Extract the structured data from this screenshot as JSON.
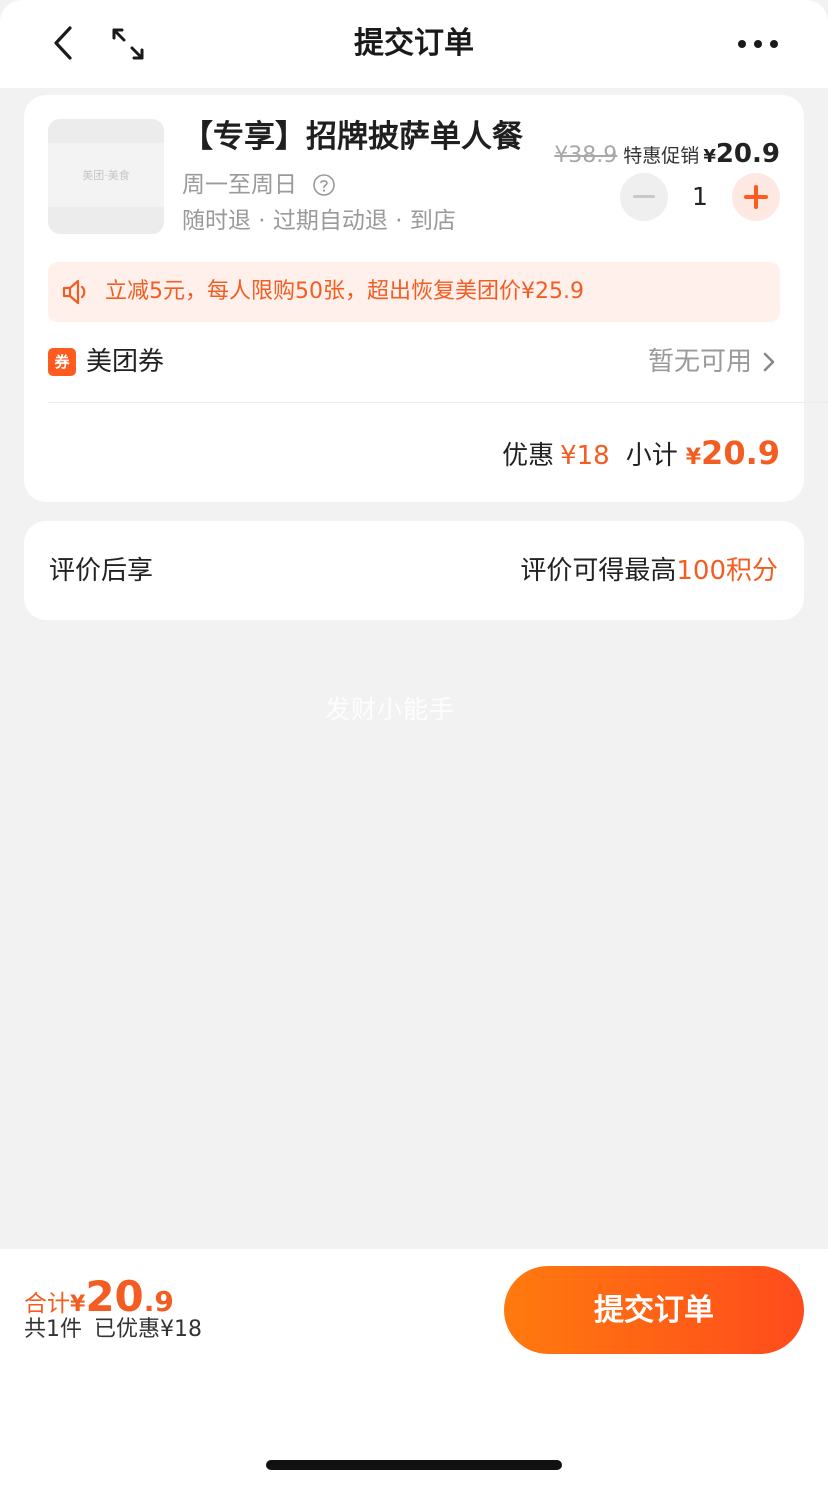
{
  "header": {
    "title": "提交订单"
  },
  "product": {
    "thumb_logo": "美团·美食",
    "title": "【专享】招牌披萨单人餐",
    "days": "周一至周日",
    "rules": "随时退 · 过期自动退 · 到店",
    "original_price": "¥38.9",
    "promo_tag": "特惠促销",
    "price_symbol": "¥",
    "price": "20.9",
    "quantity": "1"
  },
  "notice": {
    "text": "立减5元，每人限购50张，超出恢复美团价¥25.9"
  },
  "coupon": {
    "badge": "券",
    "label": "美团券",
    "value": "暂无可用"
  },
  "summary": {
    "discount_label": "优惠",
    "discount_value": "¥18",
    "subtotal_label": "小计",
    "subtotal_symbol": "¥",
    "subtotal_value": "20.9"
  },
  "review": {
    "label": "评价后享",
    "info_prefix": "评价可得最高",
    "info_highlight": "100积分"
  },
  "watermark": "发财小能手",
  "footer": {
    "total_label": "合计",
    "total_symbol": "¥",
    "total_int": "20",
    "total_dec": ".9",
    "count": "共1件",
    "saved": "已优惠¥18",
    "submit_label": "提交订单"
  },
  "colors": {
    "accent": "#f45d22",
    "button_start": "#ff7a0e",
    "button_end": "#ff4b1c"
  }
}
